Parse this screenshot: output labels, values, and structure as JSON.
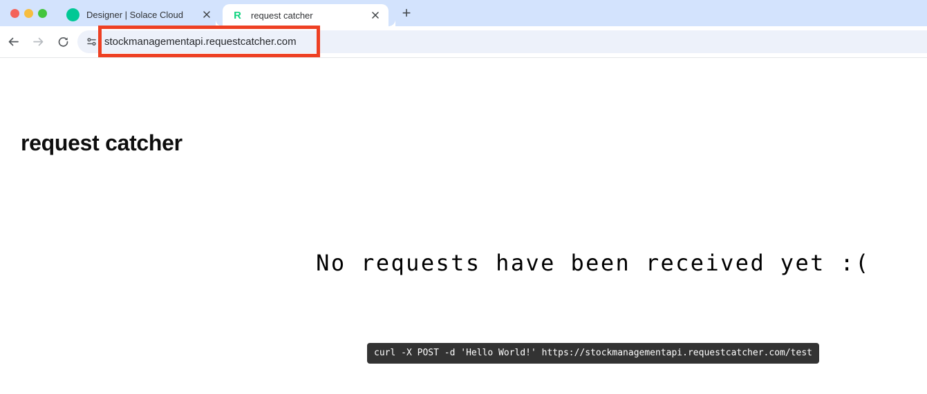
{
  "colors": {
    "tabbar_bg": "#d3e3fd",
    "active_tab_bg": "#ffffff",
    "omnibox_bg": "#edf1fa",
    "annotation_red": "#ee4023",
    "curl_box_bg": "#333333",
    "curl_box_text": "#ffffff",
    "solace_favicon_green": "#00c895",
    "request_catcher_favicon_green": "#0fd37f",
    "traffic_red": "#f4635a",
    "traffic_yellow": "#f6bd3f",
    "traffic_green": "#43c53e"
  },
  "browser": {
    "traffic_lights": [
      {
        "name": "close"
      },
      {
        "name": "minimize"
      },
      {
        "name": "zoom"
      }
    ],
    "tabs": [
      {
        "title": "Designer | Solace Cloud",
        "favicon": "solace-green-circle",
        "active": false,
        "close_label": "✕"
      },
      {
        "title": "request catcher",
        "favicon": "letter-R-green",
        "favicon_letter": "R",
        "active": true,
        "close_label": "✕"
      }
    ],
    "new_tab_label": "+",
    "nav_icons": {
      "back": "arrow-left",
      "forward": "arrow-right",
      "reload": "reload-circular-arrow",
      "site_info": "tune-sliders"
    },
    "omnibox": {
      "url": "stockmanagementapi.requestcatcher.com"
    },
    "annotation": {
      "shape": "rectangle",
      "color": "#ee4023",
      "target": "omnibox-url"
    }
  },
  "page": {
    "heading": "request catcher",
    "empty_message": "No requests have been received yet :(",
    "curl_example": "curl -X POST -d 'Hello World!' https://stockmanagementapi.requestcatcher.com/test"
  }
}
